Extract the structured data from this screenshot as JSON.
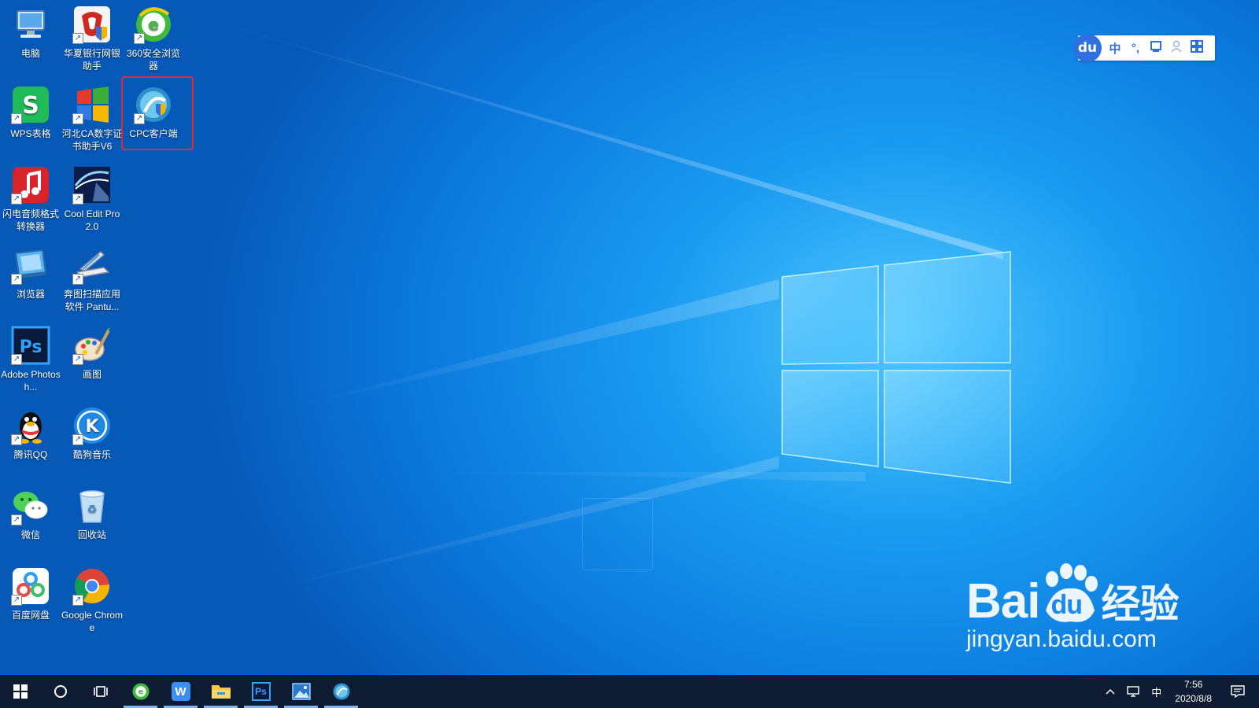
{
  "desktop": {
    "icons": [
      {
        "id": "computer",
        "label": "电脑",
        "icon": "computer-icon"
      },
      {
        "id": "huaxia",
        "label": "华夏银行网银助手",
        "icon": "bank-shield-icon"
      },
      {
        "id": "browser360",
        "label": "360安全浏览器",
        "icon": "browser-360-icon"
      },
      {
        "id": "wps",
        "label": "WPS表格",
        "icon": "wps-spreadsheet-icon"
      },
      {
        "id": "hebei-ca",
        "label": "河北CA数字证书助手V6",
        "icon": "certificate-windows-icon"
      },
      {
        "id": "cpc",
        "label": "CPC客户端",
        "icon": "cpc-client-icon"
      },
      {
        "id": "audio-converter",
        "label": "闪电音频格式转换器",
        "icon": "music-note-icon"
      },
      {
        "id": "cool-edit",
        "label": "Cool Edit Pro 2.0",
        "icon": "cool-edit-icon"
      },
      {
        "id": "browser",
        "label": "浏览器",
        "icon": "browser-windows-icon"
      },
      {
        "id": "pantum",
        "label": "奔图扫描应用软件 Pantu...",
        "icon": "scanner-icon"
      },
      {
        "id": "photoshop",
        "label": "Adobe Photosh...",
        "icon": "photoshop-icon"
      },
      {
        "id": "paint",
        "label": "画图",
        "icon": "paint-palette-icon"
      },
      {
        "id": "qq",
        "label": "腾讯QQ",
        "icon": "qq-penguin-icon"
      },
      {
        "id": "kugou",
        "label": "酷狗音乐",
        "icon": "kugou-music-icon"
      },
      {
        "id": "wechat",
        "label": "微信",
        "icon": "wechat-icon"
      },
      {
        "id": "recycle",
        "label": "回收站",
        "icon": "recycle-bin-icon"
      },
      {
        "id": "baidu-pan",
        "label": "百度网盘",
        "icon": "baidu-netdisk-icon"
      },
      {
        "id": "chrome",
        "label": "Google Chrome",
        "icon": "chrome-icon"
      }
    ],
    "selected_icon": "cpc"
  },
  "ime": {
    "logo": "du",
    "mode": "中",
    "punct": "°,",
    "items": [
      "keyboard-icon",
      "user-icon",
      "grid-icon"
    ]
  },
  "taskbar": {
    "apps": [
      "browser-360-icon",
      "wps-writer-icon",
      "file-explorer-icon",
      "photoshop-icon",
      "photos-icon",
      "cpc-client-icon"
    ],
    "ps_label": "Ps",
    "wps_label": "W",
    "tray_lang": "中",
    "time": "7:56",
    "date": "2020/8/8"
  },
  "watermark": {
    "brand": "Bai",
    "du": "du",
    "suffix": "经验",
    "url": "jingyan.baidu.com"
  },
  "colors": {
    "desktop_bg": "#0b78dc",
    "taskbar_bg": "#0d1b33",
    "selection_border": "#e0283a",
    "ime_accent": "#2f6fe0"
  }
}
